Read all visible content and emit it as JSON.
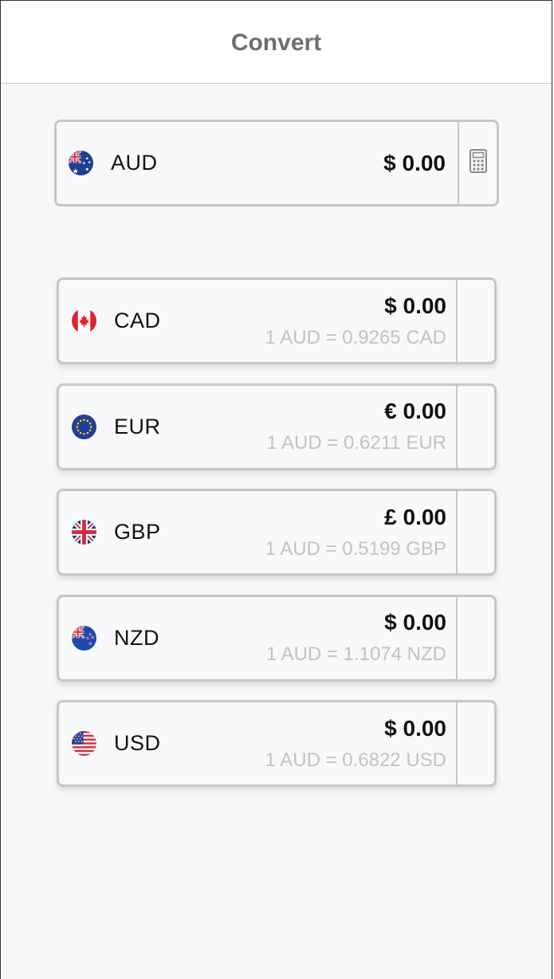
{
  "header": {
    "title": "Convert"
  },
  "base": {
    "code": "AUD",
    "amount": "$ 0.00",
    "flag_icon": "australia-flag-icon",
    "action_icon": "calculator-icon"
  },
  "rates": [
    {
      "code": "CAD",
      "amount": "$ 0.00",
      "rate": "1 AUD = 0.9265 CAD",
      "flag_icon": "canada-flag-icon"
    },
    {
      "code": "EUR",
      "amount": "€ 0.00",
      "rate": "1 AUD = 0.6211 EUR",
      "flag_icon": "eu-flag-icon"
    },
    {
      "code": "GBP",
      "amount": "£ 0.00",
      "rate": "1 AUD = 0.5199 GBP",
      "flag_icon": "uk-flag-icon"
    },
    {
      "code": "NZD",
      "amount": "$ 0.00",
      "rate": "1 AUD = 1.1074 NZD",
      "flag_icon": "new-zealand-flag-icon"
    },
    {
      "code": "USD",
      "amount": "$ 0.00",
      "rate": "1 AUD = 0.6822 USD",
      "flag_icon": "us-flag-icon"
    }
  ],
  "colors": {
    "background": "#f7f8fa",
    "border": "#c6c6c6",
    "rate_text": "#c2c2c2",
    "title_text": "#6f6f6f"
  }
}
